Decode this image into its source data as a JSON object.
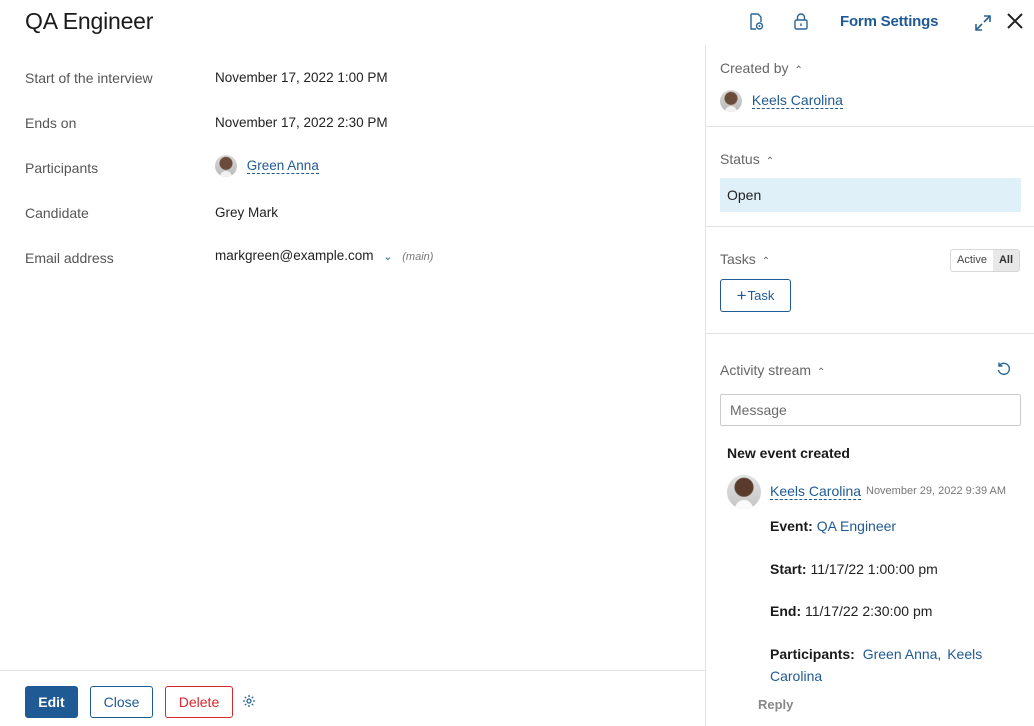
{
  "header": {
    "title": "QA Engineer",
    "form_settings_label": "Form Settings",
    "icons": [
      "document-settings-icon",
      "lock-icon",
      "expand-icon",
      "close-icon"
    ]
  },
  "fields": [
    {
      "label": "Start of the interview",
      "value": "November 17, 2022 1:00 PM"
    },
    {
      "label": "Ends on",
      "value": "November 17, 2022 2:30 PM"
    },
    {
      "label": "Participants",
      "value": "Green Anna"
    },
    {
      "label": "Candidate",
      "value": "Grey Mark"
    },
    {
      "label": "Email address",
      "value": "markgreen@example.com",
      "note": "(main)"
    }
  ],
  "footer": {
    "edit_label": "Edit",
    "close_label": "Close",
    "delete_label": "Delete"
  },
  "sidebar": {
    "created_by": {
      "title": "Created by",
      "user": "Keels Carolina"
    },
    "status": {
      "title": "Status",
      "value": "Open"
    },
    "tasks": {
      "title": "Tasks",
      "toggle_active": "Active",
      "toggle_all": "All",
      "add_label": "Task"
    },
    "activity": {
      "title": "Activity stream",
      "message_placeholder": "Message",
      "event_heading": "New event created",
      "author": "Keels Carolina",
      "timestamp": "November 29, 2022 9:39 AM",
      "event_label": "Event:",
      "event_value": "QA Engineer",
      "start_label": "Start:",
      "start_value": "11/17/22 1:00:00 pm",
      "end_label": "End:",
      "end_value": "11/17/22 2:30:00 pm",
      "participants_label": "Participants:",
      "participant_1": "Green Anna,",
      "participant_2_line1": "Keels",
      "participant_2_line2": "Carolina",
      "reply_label": "Reply"
    }
  },
  "colors": {
    "accent": "#1f5a94",
    "danger": "#d9272d",
    "status_bg": "#dff0f8",
    "divider": "#e3e3e3"
  }
}
